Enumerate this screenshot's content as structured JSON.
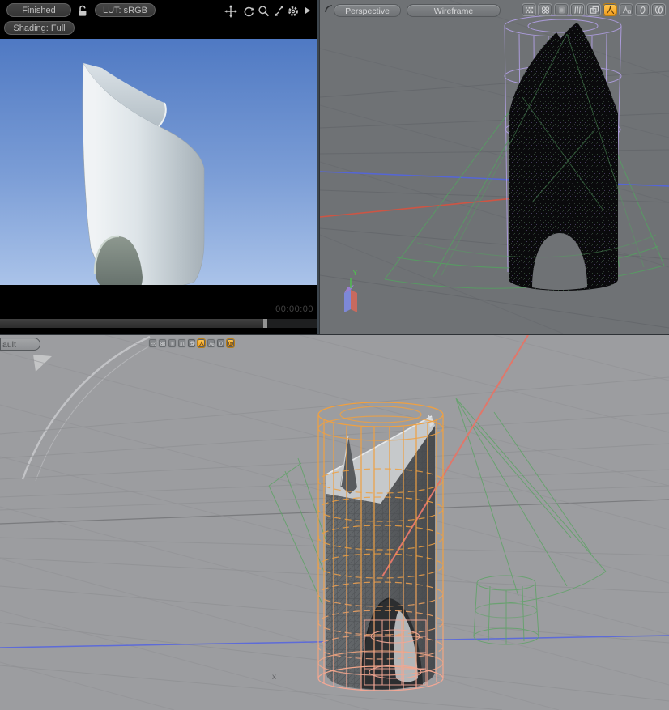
{
  "render_viewport": {
    "status_label": "Finished",
    "lut_label": "LUT: sRGB",
    "shading_label": "Shading: Full",
    "timecode": "00:00:00",
    "progress_percent": 83,
    "background_top": "#4f79c3",
    "background_bottom": "#aac3e9",
    "toolbar_icons": [
      "pan-icon",
      "rotate-icon",
      "magnify-icon",
      "fullscreen-icon",
      "gear-icon",
      "more-icon"
    ]
  },
  "perspective_viewport": {
    "view_button": "Perspective",
    "shade_button": "Wireframe",
    "axis_label": "Y",
    "background": "#6f7275",
    "toggle_icons": [
      "checker",
      "quad-circles",
      "soft-square",
      "waves",
      "overlap-squares",
      "person",
      "person-frame",
      "droplet",
      "double-droplet"
    ],
    "active_icons": [
      "person"
    ],
    "wire_colors": {
      "cage": "#b2a0e6",
      "cone": "#55a061",
      "axis_red": "#cd5544",
      "axis_blue": "#5566d6",
      "mesh": "#0a0a0c"
    }
  },
  "bottom_viewport": {
    "view_button_partial": "ault",
    "axis_label": "x",
    "background": "#9c9da0",
    "toggle_icons": [
      "checker",
      "quad-circles",
      "soft-square",
      "waves",
      "overlap-squares",
      "person",
      "person-frame",
      "droplet",
      "double-droplet"
    ],
    "active_icons": [
      "person",
      "double-droplet"
    ],
    "wire_colors": {
      "cage_top": "#efa041",
      "cage_bottom": "#f2a795",
      "cone": "#5ca364",
      "ray": "#e0776a",
      "axis_blue": "#5d6bd8"
    }
  }
}
